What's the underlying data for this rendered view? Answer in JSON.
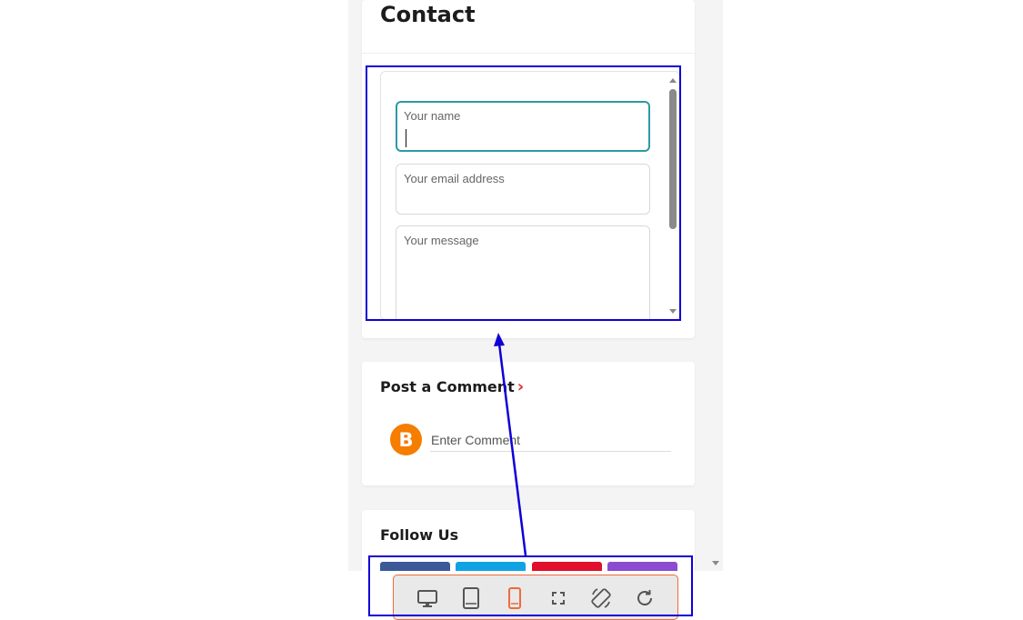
{
  "contact": {
    "title": "Contact",
    "name_placeholder": "Your name",
    "email_placeholder": "Your email address",
    "message_placeholder": "Your message"
  },
  "comment_section": {
    "title": "Post a Comment",
    "chevron": "›",
    "avatar_icon": "blogger-icon",
    "avatar_glyph": "B",
    "input_placeholder": "Enter Comment"
  },
  "follow_section": {
    "title": "Follow Us",
    "social_buttons": [
      {
        "name": "social-button-1",
        "color": "#3b5998"
      },
      {
        "name": "social-button-2",
        "color": "#0fa3e6"
      },
      {
        "name": "social-button-3",
        "color": "#e0102d"
      },
      {
        "name": "social-button-4",
        "color": "#8a4bd2"
      }
    ]
  },
  "device_toolbar": {
    "buttons": [
      {
        "icon": "desktop-icon",
        "active": false
      },
      {
        "icon": "tablet-icon",
        "active": false
      },
      {
        "icon": "mobile-icon",
        "active": true
      },
      {
        "icon": "fullscreen-icon",
        "active": false
      },
      {
        "icon": "rotate-icon",
        "active": false
      },
      {
        "icon": "reload-icon",
        "active": false
      }
    ],
    "active_color": "#ef6a3c",
    "icon_color": "#555555"
  },
  "annotations": {
    "color": "#0f00d6"
  }
}
